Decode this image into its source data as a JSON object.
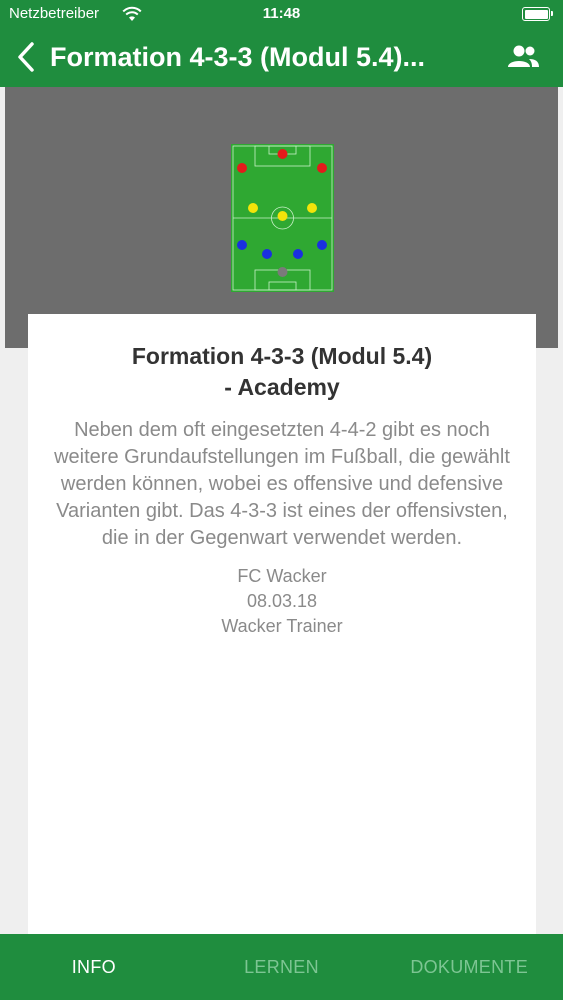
{
  "status_bar": {
    "carrier": "Netzbetreiber",
    "time": "11:48"
  },
  "nav": {
    "title": "Formation 4-3-3 (Modul 5.4)...",
    "back_icon": "chevron-left-icon",
    "people_icon": "people-icon"
  },
  "formation_image": {
    "players": [
      {
        "role": "Centre Forward",
        "color": "#e31b1b"
      },
      {
        "role": "Left Winger",
        "color": "#e31b1b"
      },
      {
        "role": "Right Winger",
        "color": "#e31b1b"
      },
      {
        "role": "Left Midfield",
        "color": "#f2e40a"
      },
      {
        "role": "Central Midfield",
        "color": "#f2e40a"
      },
      {
        "role": "Right Midfield",
        "color": "#f2e40a"
      },
      {
        "role": "Left Back",
        "color": "#1a2fe0"
      },
      {
        "role": "Centre Back",
        "color": "#1a2fe0"
      },
      {
        "role": "Centre Back",
        "color": "#1a2fe0"
      },
      {
        "role": "Right Back",
        "color": "#1a2fe0"
      },
      {
        "role": "Goalkeeper",
        "color": "#7a7a7a"
      }
    ]
  },
  "card": {
    "title_line1": "Formation 4-3-3 (Modul 5.4)",
    "title_line2": "- Academy",
    "description": "Neben dem oft eingesetzten 4-4-2 gibt es noch weitere Grundaufstellungen im Fußball, die gewählt werden können, wobei es offensive und defensive Varianten gibt. Das 4-3-3 ist eines der offensivsten, die in der Gegenwart verwendet werden.",
    "club": "FC Wacker",
    "date": "08.03.18",
    "author": "Wacker Trainer"
  },
  "tabs": [
    {
      "label": "INFO",
      "active": true
    },
    {
      "label": "LERNEN",
      "active": false
    },
    {
      "label": "DOKUMENTE",
      "active": false
    }
  ],
  "colors": {
    "brand_green": "#1f8d3e",
    "tab_inactive": "#7dc593",
    "hero_bg": "#6d6d6d"
  }
}
